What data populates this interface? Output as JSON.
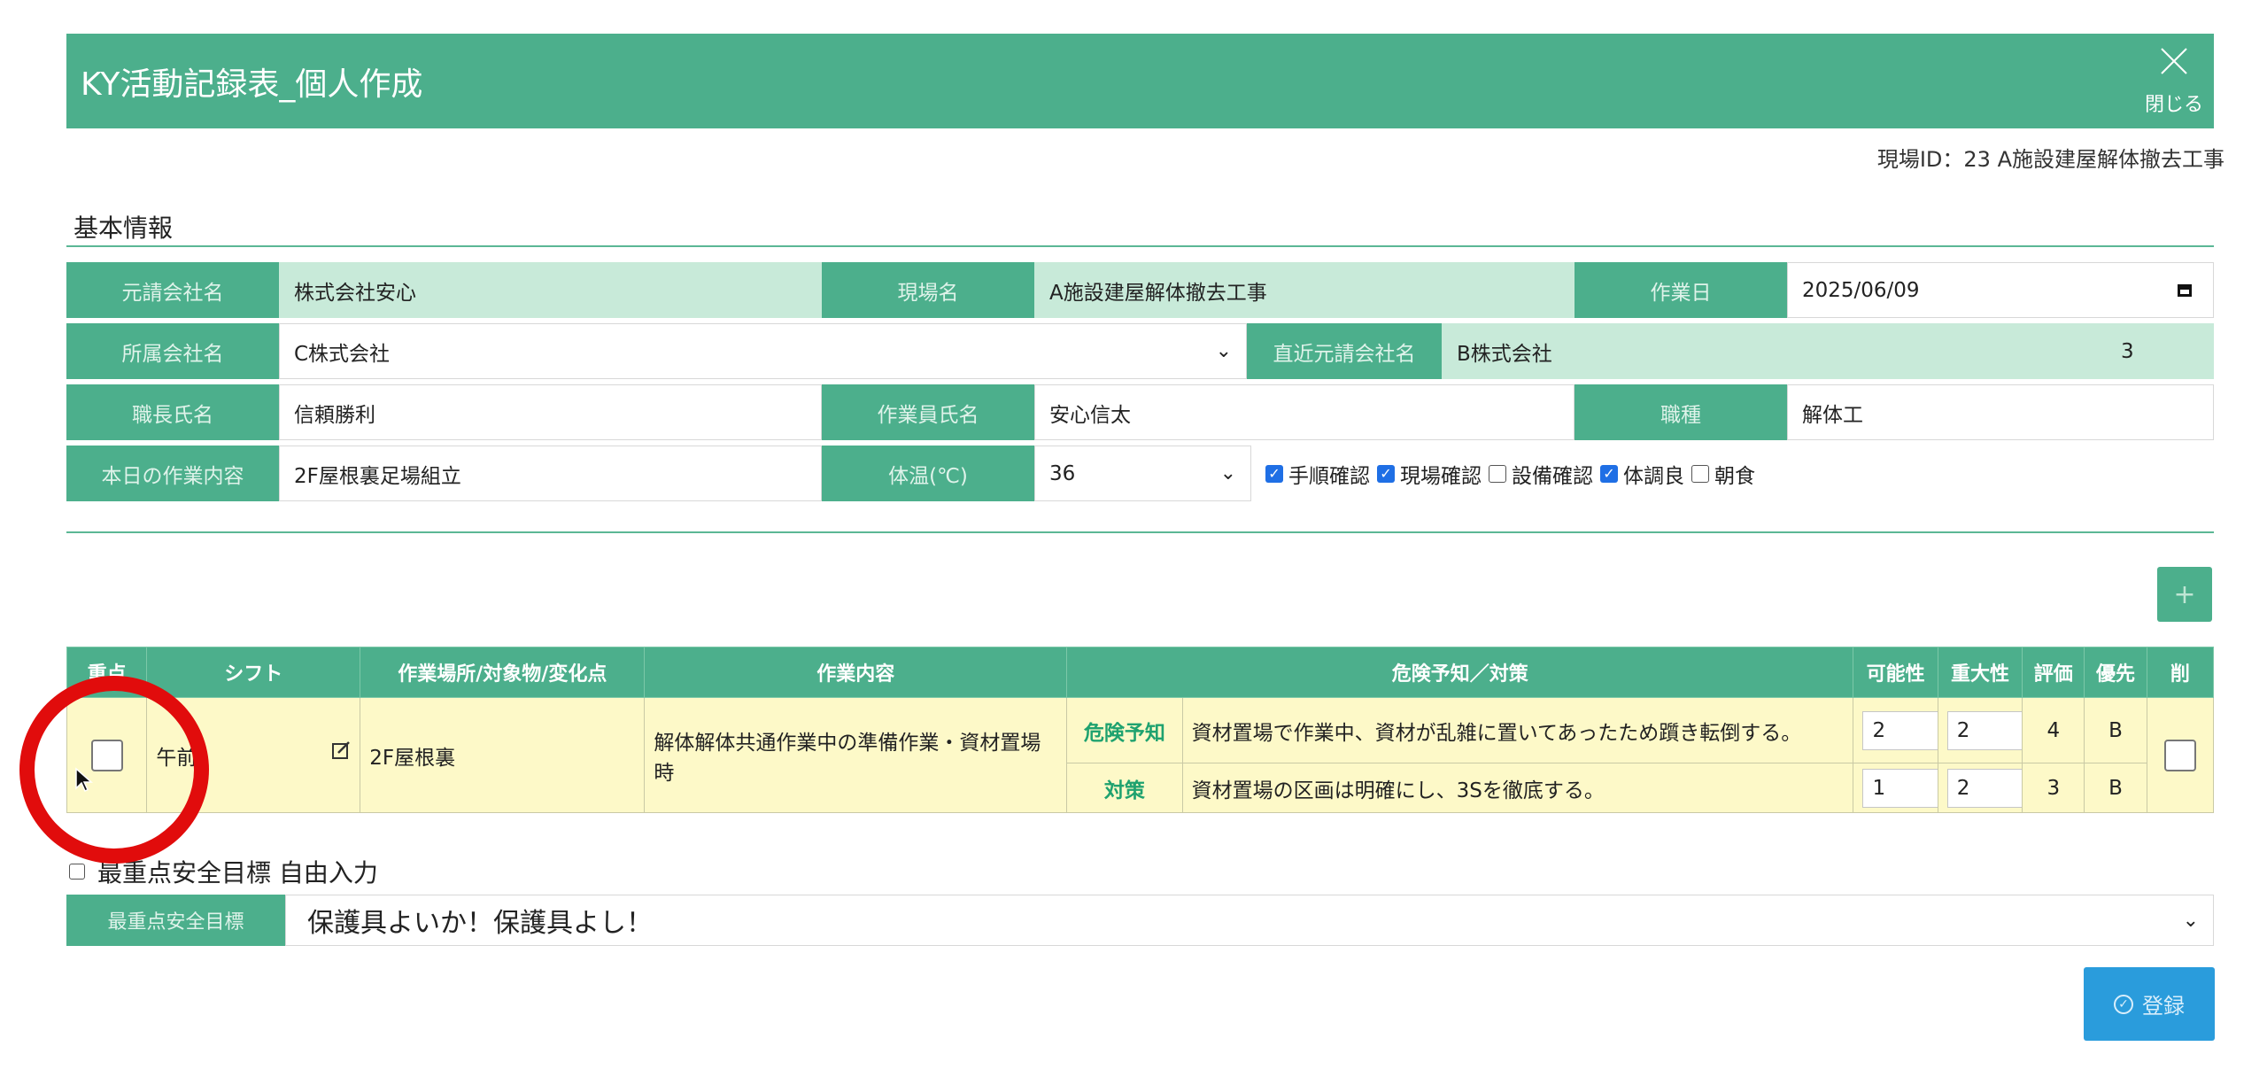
{
  "header": {
    "title": "KY活動記録表_個人作成",
    "close_label": "閉じる"
  },
  "site_id": "現場ID：23 A施設建屋解体撤去工事",
  "section_title": "基本情報",
  "info": {
    "prime_contractor_label": "元請会社名",
    "prime_contractor": "株式会社安心",
    "site_label": "現場名",
    "site": "A施設建屋解体撤去工事",
    "work_date_label": "作業日",
    "work_date": "2025/06/09",
    "company_label": "所属会社名",
    "company": "C株式会社",
    "direct_contractor_label": "直近元請会社名",
    "direct_contractor": "B株式会社",
    "tier": "3",
    "foreman_label": "職長氏名",
    "foreman": "信頼勝利",
    "worker_label": "作業員氏名",
    "worker": "安心信太",
    "trade_label": "職種",
    "trade": "解体工",
    "today_work_label": "本日の作業内容",
    "today_work": "2F屋根裏足場組立",
    "temp_label": "体温(℃)",
    "temp": "36",
    "checks": [
      {
        "label": "手順確認",
        "checked": true
      },
      {
        "label": "現場確認",
        "checked": true
      },
      {
        "label": "設備確認",
        "checked": false
      },
      {
        "label": "体調良",
        "checked": true
      },
      {
        "label": "朝食",
        "checked": false
      }
    ]
  },
  "add_label": "+",
  "table": {
    "headers": [
      "重点",
      "シフト",
      "作業場所/対象物/変化点",
      "作業内容",
      "危険予知／対策",
      "可能性",
      "重大性",
      "評価",
      "優先",
      "削"
    ],
    "row": {
      "shift": "午前",
      "place": "2F屋根裏",
      "work": "解体解体共通作業中の準備作業・資材置場時",
      "hazard_label": "危険予知",
      "hazard": "資材置場で作業中、資材が乱雑に置いてあったため躓き転倒する。",
      "hazard_possibility": "2",
      "hazard_severity": "2",
      "hazard_score": "4",
      "hazard_priority": "B",
      "measure_label": "対策",
      "measure": "資材置場の区画は明確にし、3Sを徹底する。",
      "measure_possibility": "1",
      "measure_severity": "2",
      "measure_score": "3",
      "measure_priority": "B"
    }
  },
  "free_input_label": "最重点安全目標 自由入力",
  "goal_label": "最重点安全目標",
  "goal_value": "保護具よいか！保護具よし！",
  "submit_label": "登録",
  "colors": {
    "primary": "#4caf8c",
    "cell_green": "#c8ead9",
    "row_yellow": "#fdf9c8",
    "submit_blue": "#2a9cdc",
    "highlight_red": "#e10c0c"
  }
}
